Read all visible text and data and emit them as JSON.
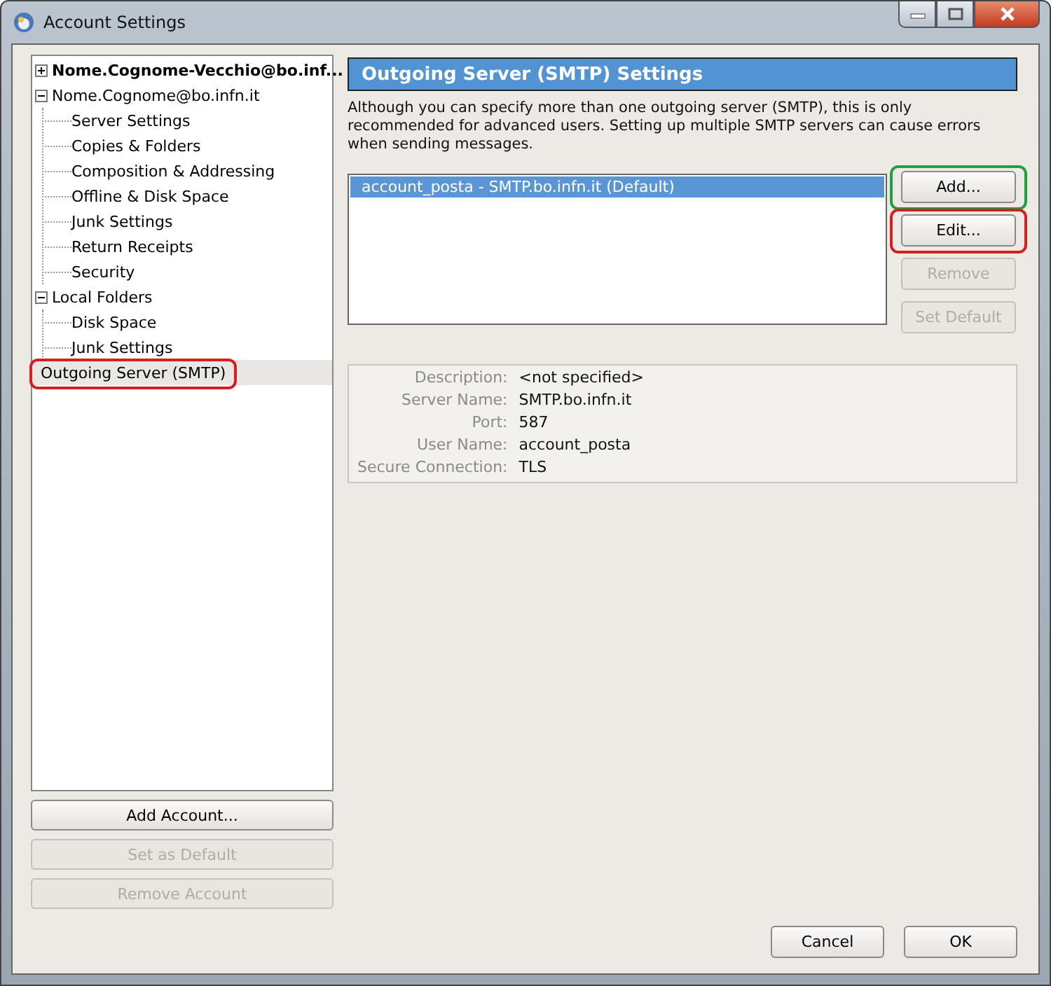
{
  "window": {
    "title": "Account Settings"
  },
  "tree": [
    {
      "label": "Nome.Cognome-Vecchio@bo.inf...",
      "bold": true,
      "expanded": false,
      "selected": false
    },
    {
      "label": "Nome.Cognome@bo.infn.it",
      "bold": false,
      "expanded": true,
      "selected": false,
      "children": [
        {
          "label": "Server Settings",
          "selected": false
        },
        {
          "label": "Copies & Folders",
          "selected": false
        },
        {
          "label": "Composition & Addressing",
          "selected": false
        },
        {
          "label": "Offline & Disk Space",
          "selected": false
        },
        {
          "label": "Junk Settings",
          "selected": false
        },
        {
          "label": "Return Receipts",
          "selected": false
        },
        {
          "label": "Security",
          "selected": false
        }
      ]
    },
    {
      "label": "Local Folders",
      "bold": false,
      "expanded": true,
      "selected": false,
      "children": [
        {
          "label": "Disk Space",
          "selected": false
        },
        {
          "label": "Junk Settings",
          "selected": false
        }
      ]
    },
    {
      "label": "Outgoing Server (SMTP)",
      "bold": false,
      "selected": true,
      "color": "#d42020"
    }
  ],
  "account_buttons": [
    {
      "label": "Add Account...",
      "disabled": false
    },
    {
      "label": "Set as Default",
      "disabled": true
    },
    {
      "label": "Remove Account",
      "disabled": true
    }
  ],
  "panel": {
    "title": "Outgoing Server (SMTP) Settings",
    "description": "Although you can specify more than one outgoing server (SMTP), this is only recommended for advanced users. Setting up multiple SMTP servers can cause errors when sending messages.",
    "servers": [
      {
        "label": "account_posta - SMTP.bo.infn.it (Default)",
        "selected": true
      }
    ],
    "buttons": [
      {
        "label": "Add...",
        "disabled": false,
        "color": "#20a040"
      },
      {
        "label": "Edit...",
        "disabled": false,
        "color": "#d42020"
      },
      {
        "label": "Remove",
        "disabled": true
      },
      {
        "label": "Set Default",
        "disabled": true
      }
    ],
    "details": [
      {
        "label": "Description:",
        "value": "<not specified>"
      },
      {
        "label": "Server Name:",
        "value": "SMTP.bo.infn.it"
      },
      {
        "label": "Port:",
        "value": "587"
      },
      {
        "label": "User Name:",
        "value": "account_posta"
      },
      {
        "label": "Secure Connection:",
        "value": "TLS"
      }
    ]
  },
  "dialog_buttons": [
    {
      "label": "Cancel"
    },
    {
      "label": "OK"
    }
  ]
}
